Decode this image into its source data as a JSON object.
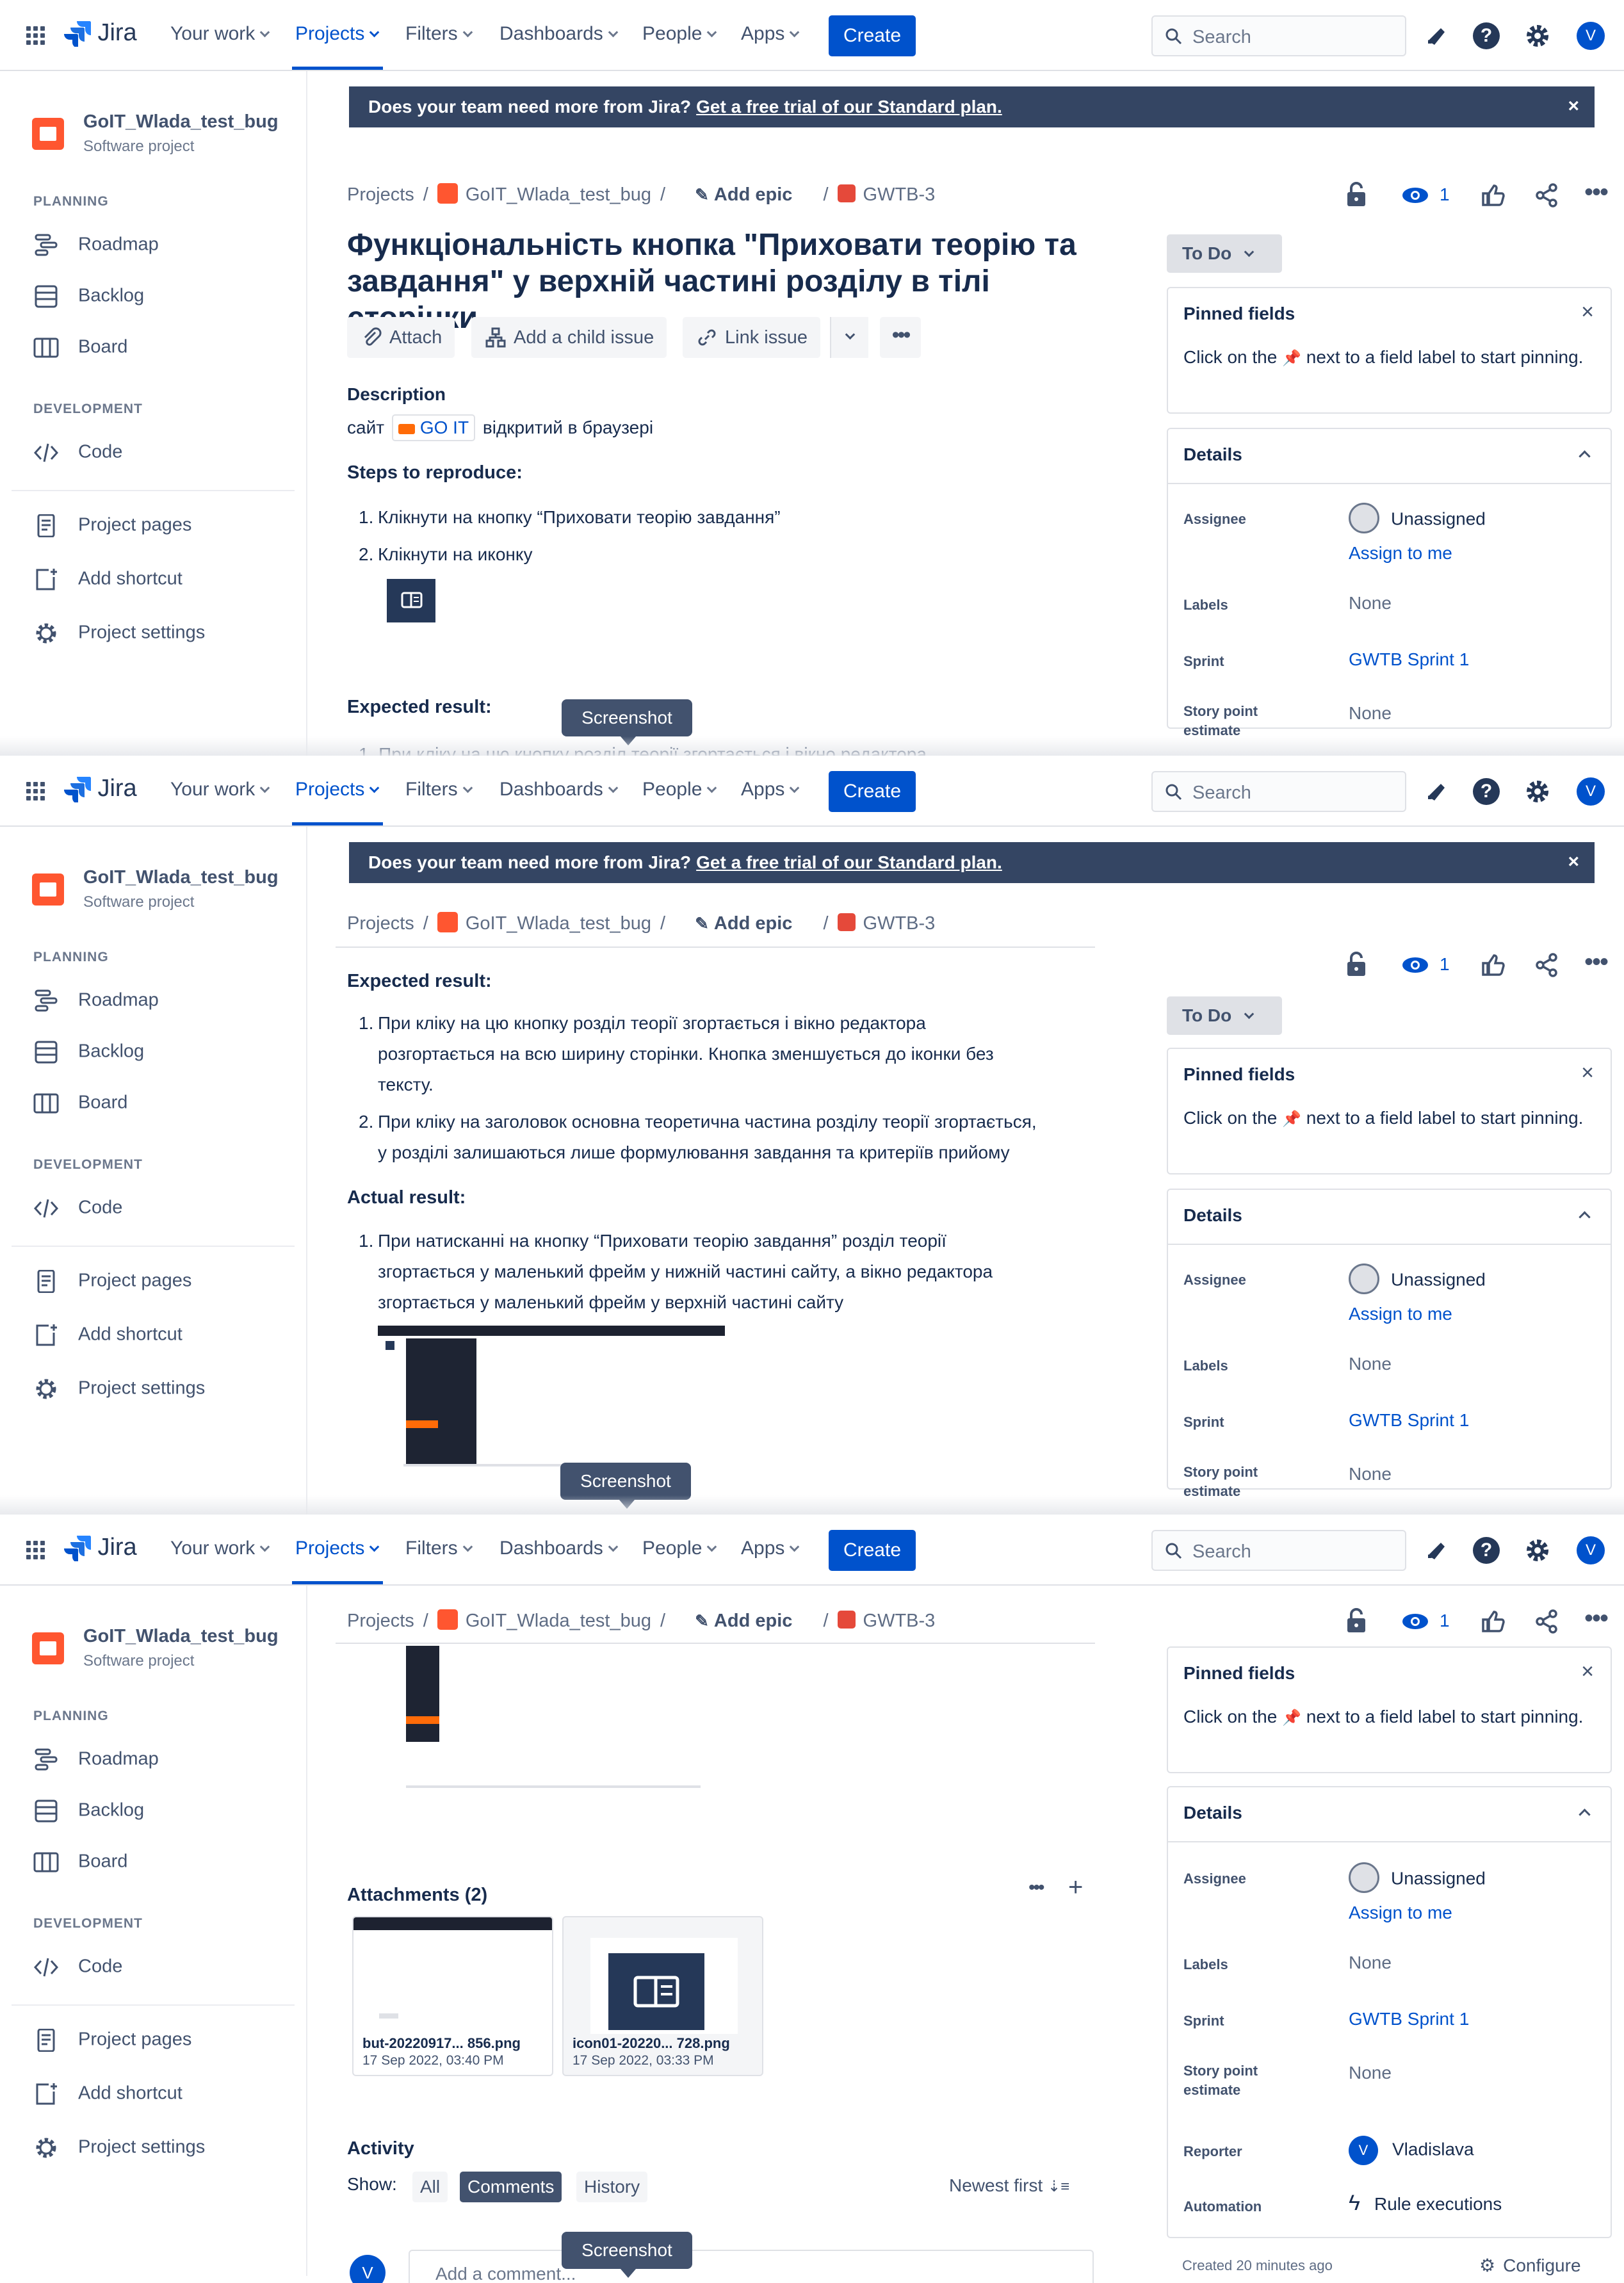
{
  "topbar": {
    "logo": "Jira",
    "nav": [
      "Your work",
      "Projects",
      "Filters",
      "Dashboards",
      "People",
      "Apps"
    ],
    "create_label": "Create",
    "search_placeholder": "Search",
    "user_initial": "V",
    "icons": [
      "app-switcher-icon",
      "notifications-icon",
      "help-icon",
      "settings-icon"
    ]
  },
  "sidebar": {
    "project_name": "GoIT_Wlada_test_bug",
    "project_type": "Software project",
    "planning_header": "PLANNING",
    "planning_items": [
      "Roadmap",
      "Backlog",
      "Board"
    ],
    "development_header": "DEVELOPMENT",
    "development_items": [
      "Code"
    ],
    "bottom_items": [
      "Project pages",
      "Add shortcut",
      "Project settings"
    ]
  },
  "banner": {
    "text": "Does your team need more from Jira?",
    "link": "Get a free trial of our Standard plan.",
    "close": "×"
  },
  "breadcrumb": {
    "projects": "Projects",
    "project": "GoIT_Wlada_test_bug",
    "add_epic": "Add epic",
    "issue_key": "GWTB-3",
    "sep": "/"
  },
  "issue": {
    "watchers": "1",
    "title": "Функціональність кнопка \"Приховати теорію та завдання\" у верхній частині розділу в тілі сторінки",
    "toolbar": [
      "Attach",
      "Add a child issue",
      "Link issue"
    ],
    "description_label": "Description",
    "description_text_before": "сайт",
    "description_chip": "GO IT",
    "description_text_after": "відкритий в браузері",
    "steps_label": "Steps to reproduce:",
    "steps": [
      "Клікнути на  кнопку “Приховати теорію завдання”",
      "Клікнути на иконку"
    ],
    "expected_label": "Expected result:",
    "expected": [
      {
        "n": "1.",
        "lines": [
          "При кліку на цю кнопку розділ теорії згортається і вікно редактора",
          "розгортається на всю ширину сторінки. Кнопка зменшується до іконки без",
          "тексту."
        ]
      },
      {
        "n": "2.",
        "lines": [
          "При кліку на заголовок основна теоретична частина розділу теорії згортається,",
          "у розділі залишаються лише формулювання завдання та критеріїв прийому"
        ]
      }
    ],
    "expected_cut": "1.  При кліку на цю кнопку розділ теорії згортається і вікно редактора",
    "actual_label": "Actual result:",
    "actual": {
      "n": "1.",
      "lines": [
        "При натисканні на  кнопку “Приховати теорію завдання” розділ теорії",
        "згортається у маленький фрейм у нижній частині сайту, а вікно редактора",
        "згортається у маленький фрейм у верхній частині сайту"
      ]
    },
    "screenshot_tip": "Screenshot"
  },
  "attachments": {
    "header": "Attachments (2)",
    "files": [
      {
        "name": "but-20220917... 856.png",
        "date": "17 Sep 2022, 03:40 PM"
      },
      {
        "name": "icon01-20220... 728.png",
        "date": "17 Sep 2022, 03:33 PM"
      }
    ]
  },
  "activity": {
    "header": "Activity",
    "show_label": "Show:",
    "filters": [
      "All",
      "Comments",
      "History"
    ],
    "active_filter": "Comments",
    "sort": "Newest first",
    "comment_placeholder": "Add a comment..."
  },
  "right": {
    "status": "To Do",
    "pinned_title": "Pinned fields",
    "pinned_text_a": "Click on the",
    "pinned_text_b": "next to a field label to start pinning.",
    "details_title": "Details",
    "assignee_label": "Assignee",
    "assignee_value": "Unassigned",
    "assign_to_me": "Assign to me",
    "labels_label": "Labels",
    "labels_value": "None",
    "sprint_label": "Sprint",
    "sprint_value": "GWTB Sprint 1",
    "story_label": "Story point estimate",
    "story_value": "None",
    "reporter_label": "Reporter",
    "reporter_value": "Vladislava",
    "automation_label": "Automation",
    "automation_value": "Rule executions",
    "created": "Created 20 minutes ago",
    "configure": "Configure"
  },
  "colors": {
    "brand": "#0052cc",
    "banner": "#344563",
    "project_logo": "#ff5630",
    "issue_type": "#e5493a",
    "nav_bg": "#ffffff"
  }
}
